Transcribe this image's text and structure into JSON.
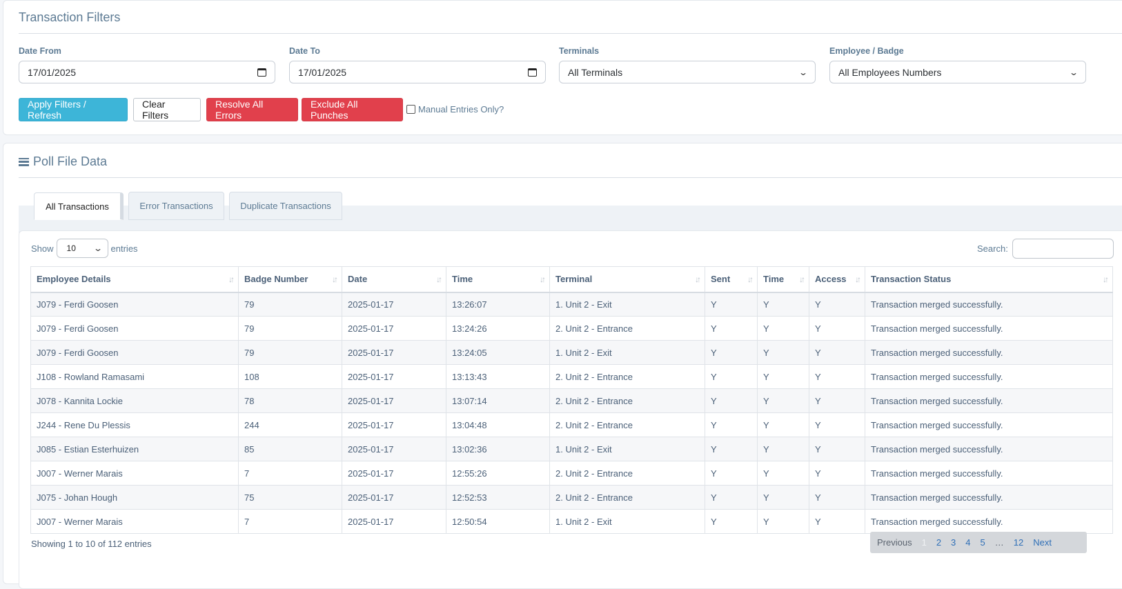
{
  "filters": {
    "title": "Transaction Filters",
    "date_from": {
      "label": "Date From",
      "value": "17/01/2025"
    },
    "date_to": {
      "label": "Date To",
      "value": "17/01/2025"
    },
    "terminals": {
      "label": "Terminals",
      "value": "All Terminals"
    },
    "employee": {
      "label": "Employee / Badge",
      "value": "All Employees Numbers"
    },
    "buttons": {
      "apply": "Apply Filters / Refresh",
      "clear": "Clear Filters",
      "resolve": "Resolve All Errors",
      "exclude": "Exclude All Punches"
    },
    "manual_only_label": "Manual Entries Only?"
  },
  "poll": {
    "title": "Poll File Data",
    "tabs": [
      "All Transactions",
      "Error Transactions",
      "Duplicate Transactions"
    ],
    "show_label": "Show",
    "entries_label": "entries",
    "page_length": "10",
    "search_label": "Search:",
    "columns": [
      "Employee Details",
      "Badge Number",
      "Date",
      "Time",
      "Terminal",
      "Sent",
      "Time",
      "Access",
      "Transaction Status"
    ],
    "rows": [
      [
        "J079 - Ferdi Goosen",
        "79",
        "2025-01-17",
        "13:26:07",
        "1. Unit 2 - Exit",
        "Y",
        "Y",
        "Y",
        "Transaction merged successfully."
      ],
      [
        "J079 - Ferdi Goosen",
        "79",
        "2025-01-17",
        "13:24:26",
        "2. Unit 2 - Entrance",
        "Y",
        "Y",
        "Y",
        "Transaction merged successfully."
      ],
      [
        "J079 - Ferdi Goosen",
        "79",
        "2025-01-17",
        "13:24:05",
        "1. Unit 2 - Exit",
        "Y",
        "Y",
        "Y",
        "Transaction merged successfully."
      ],
      [
        "J108 - Rowland Ramasami",
        "108",
        "2025-01-17",
        "13:13:43",
        "2. Unit 2 - Entrance",
        "Y",
        "Y",
        "Y",
        "Transaction merged successfully."
      ],
      [
        "J078 - Kannita Lockie",
        "78",
        "2025-01-17",
        "13:07:14",
        "2. Unit 2 - Entrance",
        "Y",
        "Y",
        "Y",
        "Transaction merged successfully."
      ],
      [
        "J244 - Rene Du Plessis",
        "244",
        "2025-01-17",
        "13:04:48",
        "2. Unit 2 - Entrance",
        "Y",
        "Y",
        "Y",
        "Transaction merged successfully."
      ],
      [
        "J085 - Estian Esterhuizen",
        "85",
        "2025-01-17",
        "13:02:36",
        "1. Unit 2 - Exit",
        "Y",
        "Y",
        "Y",
        "Transaction merged successfully."
      ],
      [
        "J007 - Werner Marais",
        "7",
        "2025-01-17",
        "12:55:26",
        "2. Unit 2 - Entrance",
        "Y",
        "Y",
        "Y",
        "Transaction merged successfully."
      ],
      [
        "J075 - Johan Hough",
        "75",
        "2025-01-17",
        "12:52:53",
        "2. Unit 2 - Entrance",
        "Y",
        "Y",
        "Y",
        "Transaction merged successfully."
      ],
      [
        "J007 - Werner Marais",
        "7",
        "2025-01-17",
        "12:50:54",
        "1. Unit 2 - Exit",
        "Y",
        "Y",
        "Y",
        "Transaction merged successfully."
      ]
    ],
    "info": "Showing 1 to 10 of 112 entries",
    "pagination": {
      "previous": "Previous",
      "pages": [
        "1",
        "2",
        "3",
        "4",
        "5"
      ],
      "ellipsis": "…",
      "last": "12",
      "next": "Next"
    }
  }
}
